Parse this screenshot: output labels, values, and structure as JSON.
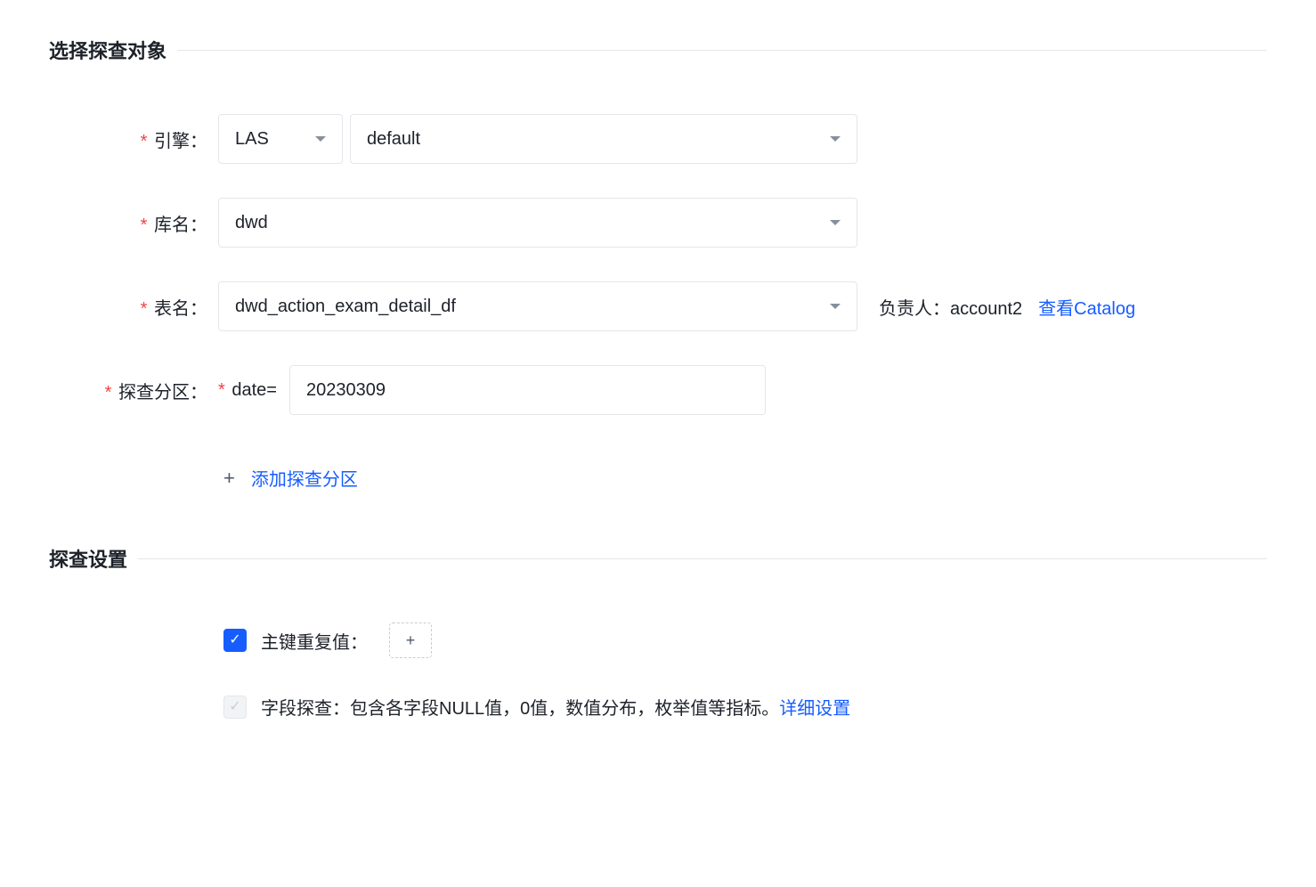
{
  "section1": {
    "title": "选择探查对象",
    "engine_label": "引擎：",
    "engine_value": "LAS",
    "default_value": "default",
    "db_label": "库名：",
    "db_value": "dwd",
    "table_label": "表名：",
    "table_value": "dwd_action_exam_detail_df",
    "owner_label": "负责人：",
    "owner_value": "account2",
    "catalog_link": "查看Catalog",
    "partition_label": "探查分区：",
    "date_label": "date=",
    "date_value": "20230309",
    "add_partition": "添加探查分区"
  },
  "section2": {
    "title": "探查设置",
    "primary_key_label": "主键重复值：",
    "field_probe_label": "字段探查：包含各字段NULL值，0值，数值分布，枚举值等指标。",
    "detail_link": "详细设置"
  }
}
